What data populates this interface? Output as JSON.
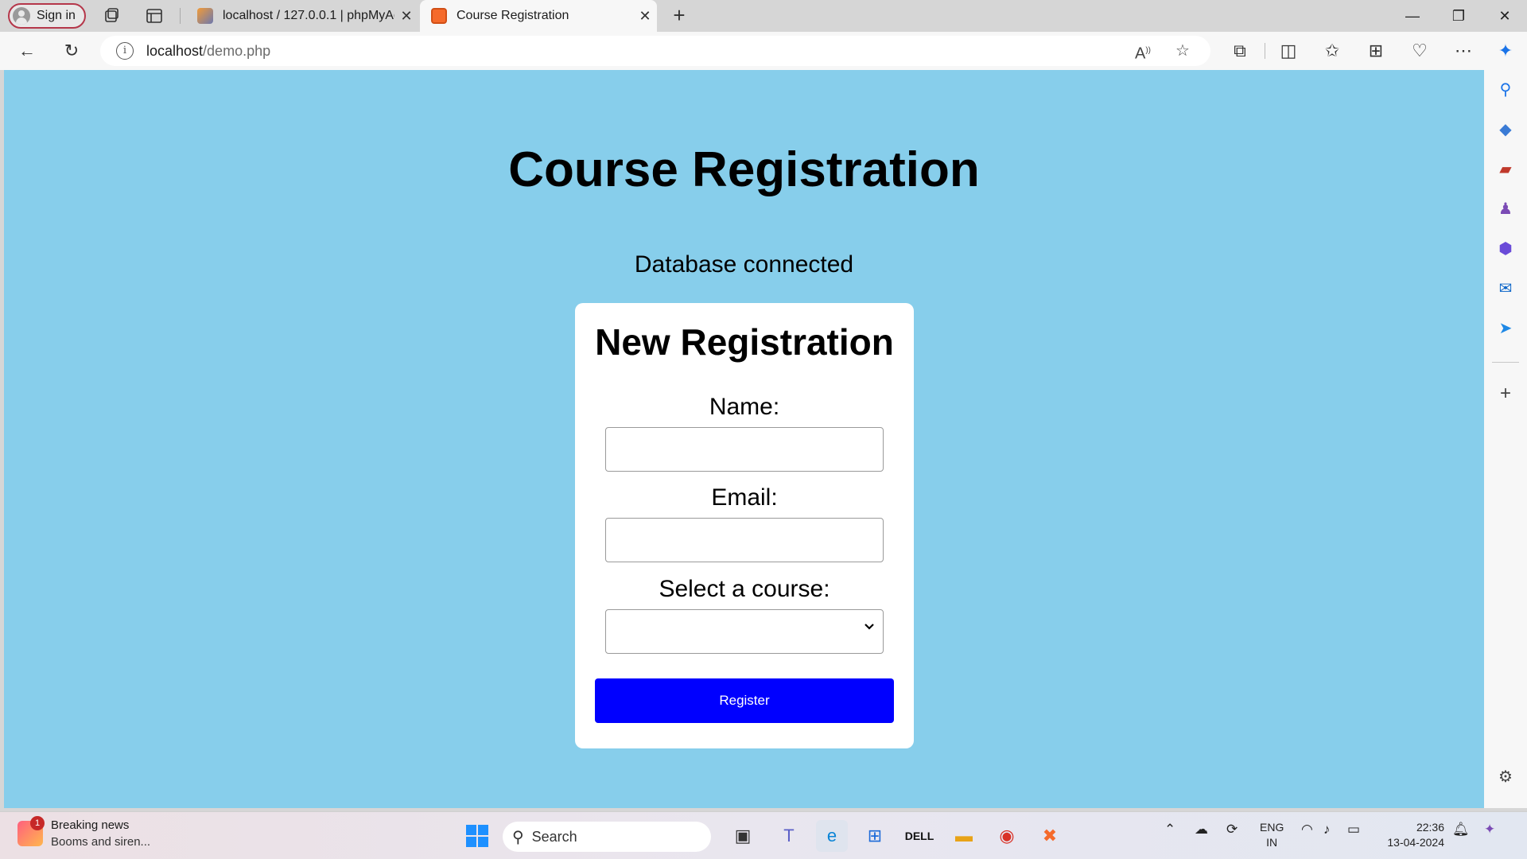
{
  "browser": {
    "signin_label": "Sign in",
    "tabs": [
      {
        "title": "localhost / 127.0.0.1 | phpMyAdmin",
        "favicon": "phpmyadmin-icon"
      },
      {
        "title": "Course Registration",
        "favicon": "xampp-icon"
      }
    ],
    "url_host": "localhost",
    "url_path": "/demo.php"
  },
  "page": {
    "heading": "Course Registration",
    "status": "Database connected",
    "form": {
      "title": "New Registration",
      "name_label": "Name:",
      "name_value": "",
      "email_label": "Email:",
      "email_value": "",
      "course_label": "Select a course:",
      "course_value": "",
      "submit_label": "Register"
    },
    "colors": {
      "background": "#87ceeb",
      "card": "#ffffff",
      "button": "#0000ff"
    }
  },
  "taskbar": {
    "news_badge": "1",
    "news_title": "Breaking news",
    "news_subtitle": "Booms and siren...",
    "search_placeholder": "Search",
    "lang_line1": "ENG",
    "lang_line2": "IN",
    "time": "22:36",
    "date": "13-04-2024"
  }
}
